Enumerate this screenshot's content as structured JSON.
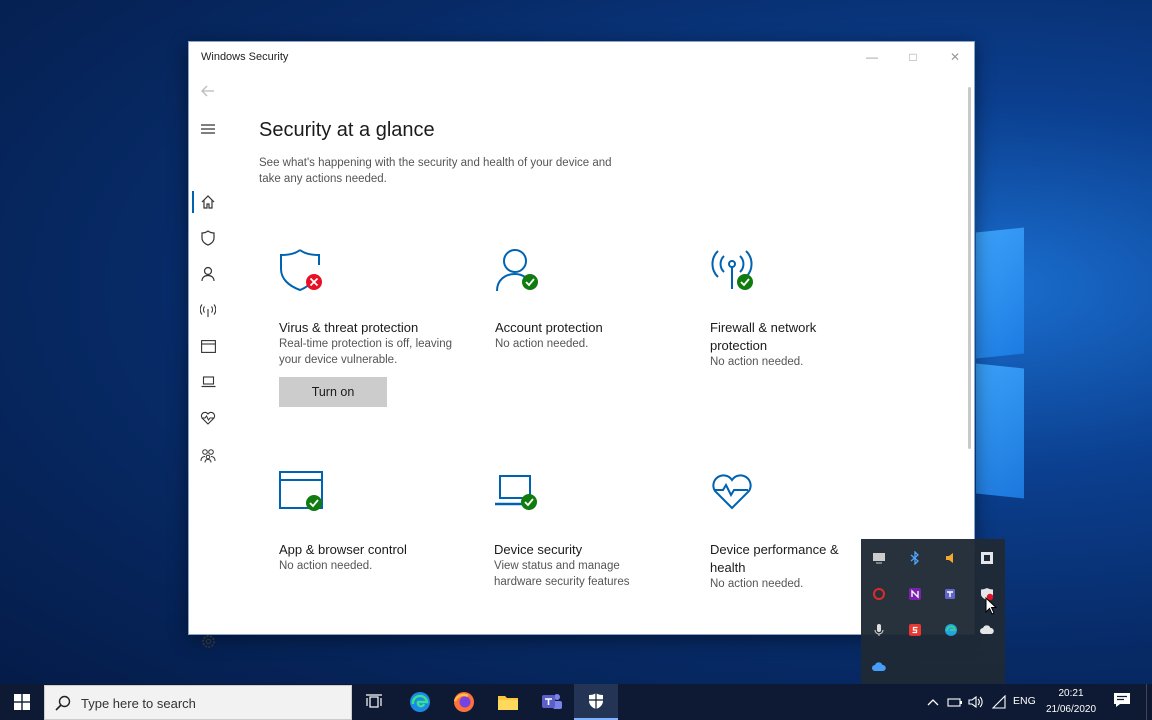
{
  "window": {
    "title": "Windows Security"
  },
  "page": {
    "title": "Security at a glance",
    "subtitle": "See what's happening with the security and health of your device and take any actions needed."
  },
  "tiles": [
    {
      "title": "Virus & threat protection",
      "desc": "Real-time protection is off, leaving your device vulnerable.",
      "button": "Turn on",
      "status": "error"
    },
    {
      "title": "Account protection",
      "desc": "No action needed.",
      "status": "ok"
    },
    {
      "title": "Firewall & network protection",
      "desc": "No action needed.",
      "status": "ok"
    },
    {
      "title": "App & browser control",
      "desc": "No action needed.",
      "status": "ok"
    },
    {
      "title": "Device security",
      "desc": "View status and manage hardware security features",
      "status": "ok"
    },
    {
      "title": "Device performance & health",
      "desc": "No action needed.",
      "status": "ok"
    }
  ],
  "colors": {
    "accent": "#0063b1",
    "ok": "#107c10",
    "error": "#e81123",
    "taskbar": "#0e1a33"
  },
  "taskbar": {
    "search_placeholder": "Type here to search",
    "language": "ENG",
    "time": "20:21",
    "date": "21/06/2020"
  }
}
